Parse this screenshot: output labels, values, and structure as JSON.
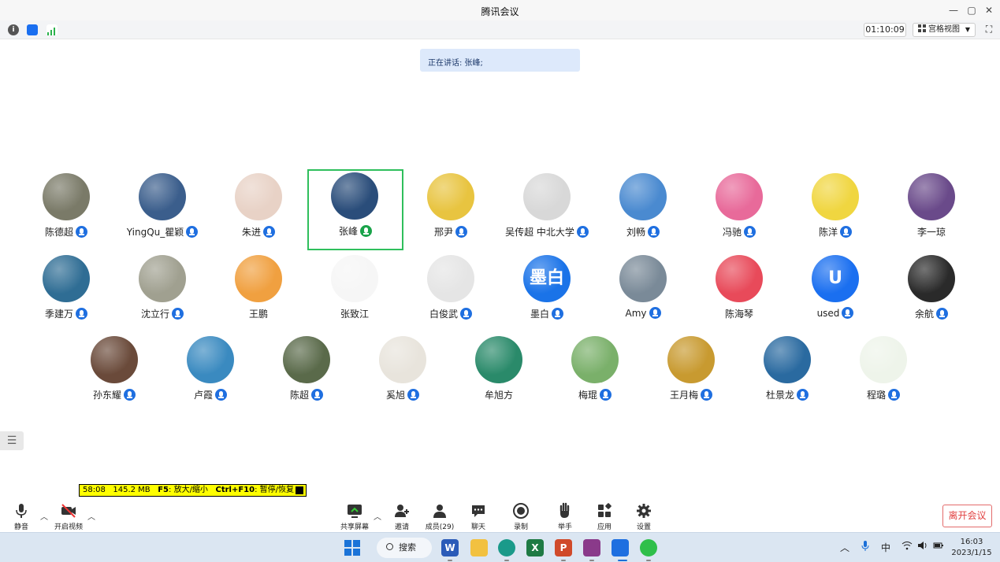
{
  "window": {
    "title": "腾讯会议"
  },
  "toolbar": {
    "timer": "01:10:09",
    "view_label": "宫格视图"
  },
  "speaking": {
    "text": "正在讲话: 张峰;"
  },
  "participants": [
    {
      "name": "陈德超",
      "mic": "blue",
      "color": "#7a7a68"
    },
    {
      "name": "YingQu_瞿颖",
      "mic": "blue",
      "color": "#3b5e8c"
    },
    {
      "name": "朱进",
      "mic": "blue",
      "color": "#e8d2c6"
    },
    {
      "name": "张峰",
      "mic": "green",
      "color": "#2a4d7a",
      "active": true
    },
    {
      "name": "邢尹",
      "mic": "blue",
      "color": "#e8c440"
    },
    {
      "name": "吴传超 中北大学",
      "mic": "blue",
      "color": "#d8d8d8"
    },
    {
      "name": "刘畅",
      "mic": "blue",
      "color": "#4a8ad0"
    },
    {
      "name": "冯驰",
      "mic": "blue",
      "color": "#e86a9a"
    },
    {
      "name": "陈洋",
      "mic": "blue",
      "color": "#f0d640"
    },
    {
      "name": "李一琼",
      "mic": "none",
      "color": "#6a4a8a"
    },
    {
      "name": "季建万",
      "mic": "blue",
      "color": "#2f6d94"
    },
    {
      "name": "沈立行",
      "mic": "blue",
      "color": "#a0a090"
    },
    {
      "name": "王鹏",
      "mic": "none",
      "color": "#f0a040"
    },
    {
      "name": "张致江",
      "mic": "none",
      "color": "#f6f6f6"
    },
    {
      "name": "白俊武",
      "mic": "blue",
      "color": "#e5e5e5"
    },
    {
      "name": "墨白",
      "mic": "blue",
      "color": "#1a73e8",
      "text": "墨白"
    },
    {
      "name": "Amy",
      "mic": "blue",
      "color": "#7a8a98"
    },
    {
      "name": "陈海琴",
      "mic": "none",
      "color": "#e84a5a"
    },
    {
      "name": "used",
      "mic": "blue",
      "color": "#1a6ff0",
      "text": "U"
    },
    {
      "name": "余航",
      "mic": "blue",
      "color": "#2a2a2a"
    },
    {
      "name": "孙东耀",
      "mic": "blue",
      "color": "#6a4a3a"
    },
    {
      "name": "卢霞",
      "mic": "blue",
      "color": "#3a8ac0"
    },
    {
      "name": "陈超",
      "mic": "blue",
      "color": "#5a6a4a"
    },
    {
      "name": "奚旭",
      "mic": "blue",
      "color": "#e8e4dc"
    },
    {
      "name": "牟旭方",
      "mic": "none",
      "color": "#2a8a6a"
    },
    {
      "name": "梅琨",
      "mic": "blue",
      "color": "#7ab06a"
    },
    {
      "name": "王月梅",
      "mic": "blue",
      "color": "#c89a30"
    },
    {
      "name": "杜景龙",
      "mic": "blue",
      "color": "#2a6aa0"
    },
    {
      "name": "程璐",
      "mic": "blue",
      "color": "#eef4ea"
    }
  ],
  "recording": {
    "time": "58:08",
    "size": "145.2 MB",
    "hint1_key": "F5",
    "hint1_text": ": 放大/缩小",
    "hint2_key": "Ctrl+F10",
    "hint2_text": ": 暂停/恢复"
  },
  "controls": {
    "mute": "静音",
    "video": "开启视频",
    "share": "共享屏幕",
    "invite": "邀请",
    "members": "成员(29)",
    "chat": "聊天",
    "record": "录制",
    "raise_hand": "举手",
    "apps": "应用",
    "settings": "设置",
    "leave": "离开会议"
  },
  "taskbar": {
    "search": "搜索",
    "ime": "中",
    "time": "16:03",
    "date": "2023/1/15"
  }
}
